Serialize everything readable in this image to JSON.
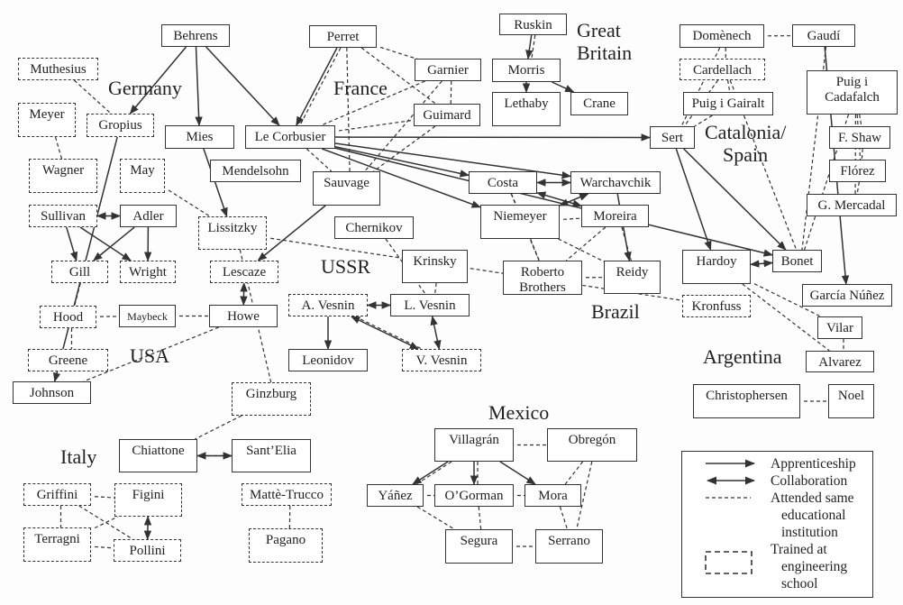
{
  "regions": [
    "Germany",
    "France",
    "Great",
    "Britain",
    "USSR",
    "USA",
    "Italy",
    "Mexico",
    "Brazil",
    "Argentina",
    "Catalonia/",
    "Spain"
  ],
  "nodes": [
    {
      "label": "Behrens",
      "dashed": false
    },
    {
      "label": "Perret",
      "dashed": false
    },
    {
      "label": "Ruskin",
      "dashed": false
    },
    {
      "label": "Morris",
      "dashed": false
    },
    {
      "label": "Lethaby",
      "dashed": false
    },
    {
      "label": "Crane",
      "dashed": false
    },
    {
      "label": "Garnier",
      "dashed": false
    },
    {
      "label": "Guimard",
      "dashed": false
    },
    {
      "label": "Muthesius",
      "dashed": true
    },
    {
      "label": "Meyer",
      "dashed": true
    },
    {
      "label": "Gropius",
      "dashed": true
    },
    {
      "label": "Mies",
      "dashed": false
    },
    {
      "label": "Le Corbusier",
      "dashed": false
    },
    {
      "label": "Mendelsohn",
      "dashed": false
    },
    {
      "label": "Sauvage",
      "dashed": false
    },
    {
      "label": "Wagner",
      "dashed": true
    },
    {
      "label": "May",
      "dashed": true
    },
    {
      "label": "Sullivan",
      "dashed": true
    },
    {
      "label": "Adler",
      "dashed": false
    },
    {
      "label": "Lissitzky",
      "dashed": true
    },
    {
      "label": "Gill",
      "dashed": true
    },
    {
      "label": "Wright",
      "dashed": true
    },
    {
      "label": "Lescaze",
      "dashed": true
    },
    {
      "label": "Hood",
      "dashed": true
    },
    {
      "label": "Maybeck",
      "dashed": false
    },
    {
      "label": "Howe",
      "dashed": false
    },
    {
      "label": "Greene",
      "dashed": true
    },
    {
      "label": "Johnson",
      "dashed": false
    },
    {
      "label": "Chernikov",
      "dashed": false
    },
    {
      "label": "Krinsky",
      "dashed": false
    },
    {
      "label": "A. Vesnin",
      "dashed": true
    },
    {
      "label": "L. Vesnin",
      "dashed": false
    },
    {
      "label": "Leonidov",
      "dashed": false
    },
    {
      "label": "V. Vesnin",
      "dashed": true
    },
    {
      "label": "Ginzburg",
      "dashed": true
    },
    {
      "label": "Chiattone",
      "dashed": false
    },
    {
      "label": "Sant’Elia",
      "dashed": false
    },
    {
      "label": "Griffini",
      "dashed": true
    },
    {
      "label": "Figini",
      "dashed": true
    },
    {
      "label": "Terragni",
      "dashed": true
    },
    {
      "label": "Pollini",
      "dashed": true
    },
    {
      "label": "Mattè-Trucco",
      "dashed": true
    },
    {
      "label": "Pagano",
      "dashed": true
    },
    {
      "label": "Costa",
      "dashed": false
    },
    {
      "label": "Warchavchik",
      "dashed": false
    },
    {
      "label": "Niemeyer",
      "dashed": false
    },
    {
      "label": "Moreira",
      "dashed": false
    },
    {
      "label": "Roberto Brothers",
      "dashed": false
    },
    {
      "label": "Reidy",
      "dashed": false
    },
    {
      "label": "Sert",
      "dashed": false
    },
    {
      "label": "Domènech",
      "dashed": false
    },
    {
      "label": "Cardellach",
      "dashed": true
    },
    {
      "label": "Puig i Gairalt",
      "dashed": false
    },
    {
      "label": "Gaudí",
      "dashed": false
    },
    {
      "label": "Puig i Cadafalch",
      "dashed": false
    },
    {
      "label": "F. Shaw",
      "dashed": false
    },
    {
      "label": "Flórez",
      "dashed": false
    },
    {
      "label": "G. Mercadal",
      "dashed": false
    },
    {
      "label": "Hardoy",
      "dashed": false
    },
    {
      "label": "Bonet",
      "dashed": false
    },
    {
      "label": "García Núñez",
      "dashed": false
    },
    {
      "label": "Kronfuss",
      "dashed": true
    },
    {
      "label": "Vilar",
      "dashed": false
    },
    {
      "label": "Alvarez",
      "dashed": false
    },
    {
      "label": "Christophersen",
      "dashed": false
    },
    {
      "label": "Noel",
      "dashed": false
    },
    {
      "label": "Villagrán",
      "dashed": false
    },
    {
      "label": "Obregón",
      "dashed": false
    },
    {
      "label": "Yáñez",
      "dashed": false
    },
    {
      "label": "O’Gorman",
      "dashed": false
    },
    {
      "label": "Mora",
      "dashed": false
    },
    {
      "label": "Segura",
      "dashed": false
    },
    {
      "label": "Serrano",
      "dashed": false
    }
  ],
  "edges": [
    [
      "Behrens",
      "Gropius",
      "apprenticeship"
    ],
    [
      "Behrens",
      "Mies",
      "apprenticeship"
    ],
    [
      "Behrens",
      "Le Corbusier",
      "apprenticeship"
    ],
    [
      "Perret",
      "Le Corbusier",
      "apprenticeship"
    ],
    [
      "Perret",
      "Garnier",
      "school"
    ],
    [
      "Perret",
      "Sauvage",
      "school"
    ],
    [
      "Perret",
      "Guimard",
      "school"
    ],
    [
      "Perret",
      "Le Corbusier",
      "school"
    ],
    [
      "Garnier",
      "Le Corbusier",
      "school"
    ],
    [
      "Guimard",
      "Le Corbusier",
      "school"
    ],
    [
      "Garnier",
      "Sauvage",
      "school"
    ],
    [
      "Guimard",
      "Sauvage",
      "school"
    ],
    [
      "Garnier",
      "Guimard",
      "school"
    ],
    [
      "Muthesius",
      "Gropius",
      "school"
    ],
    [
      "Meyer",
      "Wagner",
      "school"
    ],
    [
      "Ruskin",
      "Morris",
      "apprenticeship"
    ],
    [
      "Ruskin",
      "Morris",
      "school"
    ],
    [
      "Morris",
      "Lethaby",
      "apprenticeship"
    ],
    [
      "Morris",
      "Crane",
      "apprenticeship"
    ],
    [
      "Le Corbusier",
      "Sert",
      "apprenticeship"
    ],
    [
      "Le Corbusier",
      "Bonet",
      "apprenticeship"
    ],
    [
      "Le Corbusier",
      "Costa",
      "apprenticeship"
    ],
    [
      "Le Corbusier",
      "Niemeyer",
      "apprenticeship"
    ],
    [
      "Le Corbusier",
      "Warchavchik",
      "apprenticeship"
    ],
    [
      "Le Corbusier",
      "Sauvage",
      "school"
    ],
    [
      "Sauvage",
      "Lescaze",
      "apprenticeship"
    ],
    [
      "Mies",
      "Lissitzky",
      "apprenticeship"
    ],
    [
      "Sullivan",
      "Adler",
      "collaboration"
    ],
    [
      "Sullivan",
      "Gill",
      "apprenticeship"
    ],
    [
      "Sullivan",
      "Wright",
      "apprenticeship"
    ],
    [
      "Adler",
      "Gill",
      "apprenticeship"
    ],
    [
      "Adler",
      "Wright",
      "apprenticeship"
    ],
    [
      "Lescaze",
      "Howe",
      "collaboration"
    ],
    [
      "Hood",
      "Maybeck",
      "school"
    ],
    [
      "Maybeck",
      "Howe",
      "school"
    ],
    [
      "Howe",
      "Johnson",
      "school"
    ],
    [
      "Hood",
      "Greene",
      "school"
    ],
    [
      "Gill",
      "Hood",
      "school"
    ],
    [
      "May",
      "Lissitzky",
      "school"
    ],
    [
      "Lissitzky",
      "Ginzburg",
      "school"
    ],
    [
      "Gropius",
      "Johnson",
      "apprenticeship"
    ],
    [
      "Ginzburg",
      "Chiattone",
      "school"
    ],
    [
      "Chiattone",
      "Sant’Elia",
      "collaboration"
    ],
    [
      "Chiattone",
      "Sant’Elia",
      "school"
    ],
    [
      "Griffini",
      "Figini",
      "school"
    ],
    [
      "Griffini",
      "Terragni",
      "school"
    ],
    [
      "Griffini",
      "Pollini",
      "school"
    ],
    [
      "Terragni",
      "Figini",
      "school"
    ],
    [
      "Terragni",
      "Pollini",
      "school"
    ],
    [
      "Figini",
      "Pollini",
      "collaboration"
    ],
    [
      "Mattè-Trucco",
      "Pagano",
      "school"
    ],
    [
      "Chernikov",
      "L. Vesnin",
      "school"
    ],
    [
      "Krinsky",
      "L. Vesnin",
      "school"
    ],
    [
      "A. Vesnin",
      "L. Vesnin",
      "collaboration"
    ],
    [
      "A. Vesnin",
      "Leonidov",
      "apprenticeship"
    ],
    [
      "A. Vesnin",
      "V. Vesnin",
      "collaboration"
    ],
    [
      "L. Vesnin",
      "V. Vesnin",
      "collaboration"
    ],
    [
      "A. Vesnin",
      "V. Vesnin",
      "school"
    ],
    [
      "Kronfuss",
      "Lissitzky",
      "school"
    ],
    [
      "Costa",
      "Warchavchik",
      "collaboration"
    ],
    [
      "Costa",
      "Moreira",
      "collaboration"
    ],
    [
      "Niemeyer",
      "Warchavchik",
      "collaboration"
    ],
    [
      "Niemeyer",
      "Moreira",
      "school"
    ],
    [
      "Costa",
      "Niemeyer",
      "school"
    ],
    [
      "Warchavchik",
      "Reidy",
      "apprenticeship"
    ],
    [
      "Moreira",
      "Reidy",
      "school"
    ],
    [
      "Roberto Brothers",
      "Reidy",
      "school"
    ],
    [
      "Niemeyer",
      "Roberto Brothers",
      "school"
    ],
    [
      "Niemeyer",
      "Reidy",
      "school"
    ],
    [
      "Moreira",
      "Roberto Brothers",
      "school"
    ],
    [
      "Costa",
      "Roberto Brothers",
      "school"
    ],
    [
      "Domènech",
      "Gaudí",
      "school"
    ],
    [
      "Domènech",
      "Cardellach",
      "school"
    ],
    [
      "Cardellach",
      "Puig i Gairalt",
      "school"
    ],
    [
      "Domènech",
      "Sert",
      "school"
    ],
    [
      "Cardellach",
      "Sert",
      "school"
    ],
    [
      "Puig i Gairalt",
      "Sert",
      "school"
    ],
    [
      "Gaudí",
      "Bonet",
      "school"
    ],
    [
      "Cardellach",
      "Bonet",
      "school"
    ],
    [
      "Puig i Cadafalch",
      "Bonet",
      "school"
    ],
    [
      "Puig i Cadafalch",
      "F. Shaw",
      "school"
    ],
    [
      "Puig i Cadafalch",
      "Flórez",
      "school"
    ],
    [
      "Puig i Cadafalch",
      "G. Mercadal",
      "school"
    ],
    [
      "F. Shaw",
      "Flórez",
      "school"
    ],
    [
      "Flórez",
      "G. Mercadal",
      "school"
    ],
    [
      "Sert",
      "Bonet",
      "apprenticeship"
    ],
    [
      "Sert",
      "Hardoy",
      "apprenticeship"
    ],
    [
      "Hardoy",
      "Bonet",
      "collaboration"
    ],
    [
      "Gaudí",
      "García Núñez",
      "apprenticeship"
    ],
    [
      "Hardoy",
      "Vilar",
      "school"
    ],
    [
      "Hardoy",
      "Alvarez",
      "school"
    ],
    [
      "Vilar",
      "Alvarez",
      "school"
    ],
    [
      "Christophersen",
      "Noel",
      "school"
    ],
    [
      "Villagrán",
      "Obregón",
      "school"
    ],
    [
      "Villagrán",
      "Yáñez",
      "apprenticeship"
    ],
    [
      "Villagrán",
      "O’Gorman",
      "apprenticeship"
    ],
    [
      "Villagrán",
      "Mora",
      "apprenticeship"
    ],
    [
      "Villagrán",
      "O’Gorman",
      "school"
    ],
    [
      "Villagrán",
      "Yáñez",
      "school"
    ],
    [
      "Yáñez",
      "O’Gorman",
      "school"
    ],
    [
      "O’Gorman",
      "Mora",
      "school"
    ],
    [
      "Obregón",
      "Mora",
      "school"
    ],
    [
      "Obregón",
      "Serrano",
      "school"
    ],
    [
      "O’Gorman",
      "Segura",
      "school"
    ],
    [
      "Mora",
      "Serrano",
      "school"
    ],
    [
      "Segura",
      "Serrano",
      "school"
    ],
    [
      "Yáñez",
      "Segura",
      "school"
    ]
  ],
  "legend": {
    "apprenticeship": "Apprenticeship",
    "collaboration": "Collaboration",
    "school_line1": "Attended same",
    "school_line2": "educational",
    "school_line3": "institution",
    "engineering_line1": "Trained at",
    "engineering_line2": "engineering",
    "engineering_line3": "school"
  },
  "colors": {
    "line": "#333333",
    "background": "#ffffff"
  }
}
